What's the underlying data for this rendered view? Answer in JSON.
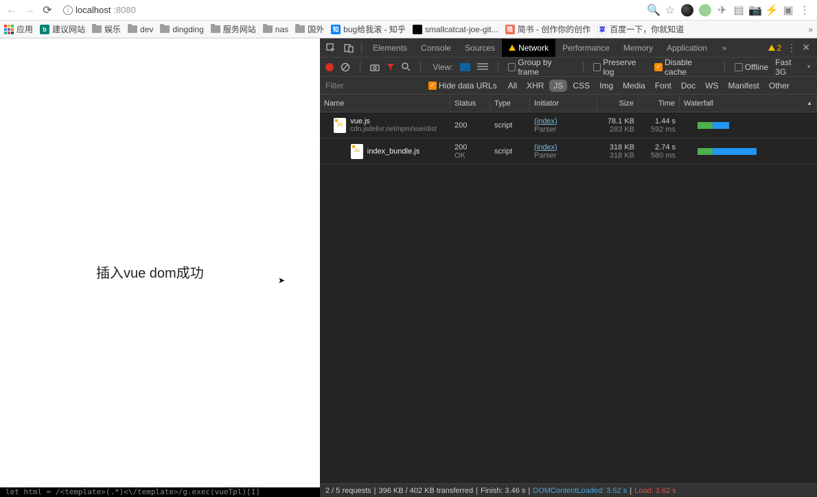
{
  "browser": {
    "url_host": "localhost",
    "url_port": ":8080"
  },
  "bookmarks": {
    "apps_label": "应用",
    "items": [
      {
        "kind": "favicon",
        "cls": "fav-bing",
        "glyph": "b",
        "label": "建议网站"
      },
      {
        "kind": "folder",
        "label": "娱乐"
      },
      {
        "kind": "folder",
        "label": "dev"
      },
      {
        "kind": "folder",
        "label": "dingding"
      },
      {
        "kind": "folder",
        "label": "服务网站"
      },
      {
        "kind": "folder",
        "label": "nas"
      },
      {
        "kind": "folder",
        "label": "国外"
      },
      {
        "kind": "favicon",
        "cls": "fav-zhihu",
        "glyph": "知",
        "label": "bug给我滚 - 知乎"
      },
      {
        "kind": "favicon",
        "cls": "fav-github",
        "glyph": "",
        "label": "smallcatcat-joe-git..."
      },
      {
        "kind": "favicon",
        "cls": "fav-jianshu",
        "glyph": "简",
        "label": "简书 - 创作你的创作"
      },
      {
        "kind": "favicon",
        "cls": "fav-baidu",
        "glyph": "掌",
        "label": "百度一下，你就知道"
      }
    ]
  },
  "page": {
    "text": "插入vue dom成功"
  },
  "devtools": {
    "tabs": [
      "Elements",
      "Console",
      "Sources",
      "Network",
      "Performance",
      "Memory",
      "Application"
    ],
    "active_tab": "Network",
    "warn_count": "2",
    "toolbar": {
      "view_label": "View:",
      "group_by_frame": "Group by frame",
      "preserve_log": "Preserve log",
      "disable_cache": "Disable cache",
      "offline": "Offline",
      "throttle": "Fast 3G"
    },
    "filter": {
      "placeholder": "Filter",
      "hide_data_urls": "Hide data URLs",
      "types": [
        "All",
        "XHR",
        "JS",
        "CSS",
        "Img",
        "Media",
        "Font",
        "Doc",
        "WS",
        "Manifest",
        "Other"
      ],
      "active_type": "JS"
    },
    "columns": {
      "name": "Name",
      "status": "Status",
      "type": "Type",
      "initiator": "Initiator",
      "size": "Size",
      "time": "Time",
      "waterfall": "Waterfall"
    },
    "rows": [
      {
        "name": "vue.js",
        "name_sub": "cdn.jsdelivr.net/npm/vue/dist",
        "status": "200",
        "status_sub": "",
        "type": "script",
        "initiator": "(index)",
        "initiator_sub": "Parser",
        "size": "78.1 KB",
        "size_sub": "283 KB",
        "time": "1.44 s",
        "time_sub": "592 ms",
        "wf": {
          "offset": 20,
          "q": 0,
          "g": 22,
          "b": 24
        }
      },
      {
        "name": "index_bundle.js",
        "name_sub": "",
        "status": "200",
        "status_sub": "OK",
        "type": "script",
        "initiator": "(index)",
        "initiator_sub": "Parser",
        "size": "318 KB",
        "size_sub": "318 KB",
        "time": "2.74 s",
        "time_sub": "580 ms",
        "wf": {
          "offset": 20,
          "q": 0,
          "g": 22,
          "b": 64
        }
      }
    ],
    "status": {
      "requests": "2 / 5 requests",
      "transferred": "396 KB / 402 KB transferred",
      "finish": "Finish: 3.46 s",
      "dcl": "DOMContentLoaded: 3.52 s",
      "load": "Load: 3.62 s"
    }
  },
  "terminal_snippet": "let html = /<template>(.*)<\\/template>/g.exec(vueTpl)[1]"
}
